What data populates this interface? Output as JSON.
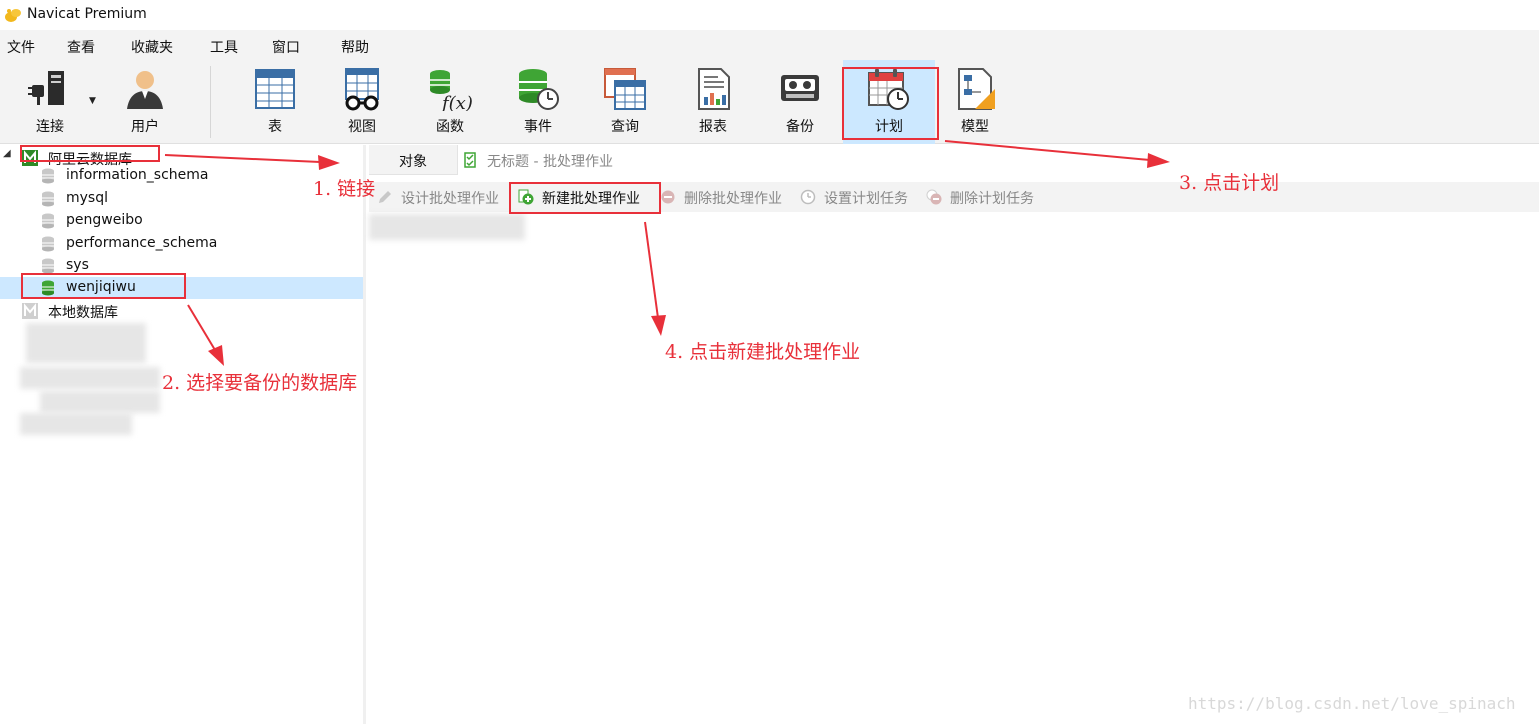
{
  "window": {
    "title": "Navicat Premium"
  },
  "menu": [
    "文件",
    "查看",
    "收藏夹",
    "工具",
    "窗口",
    "帮助"
  ],
  "toolbar": {
    "connect": "连接",
    "user": "用户",
    "table": "表",
    "view": "视图",
    "function": "函数",
    "event": "事件",
    "query": "查询",
    "report": "报表",
    "backup": "备份",
    "plan": "计划",
    "model": "模型",
    "active": "plan"
  },
  "sidebar": {
    "connection": "阿里云数据库",
    "databases": [
      "information_schema",
      "mysql",
      "pengweibo",
      "performance_schema",
      "sys",
      "wenjiqiwu"
    ],
    "selected": "wenjiqiwu",
    "local_connection": "本地数据库"
  },
  "tabs": {
    "objects": "对象",
    "batchjob_title": "无标题 - 批处理作业"
  },
  "actions": {
    "design": "设计批处理作业",
    "new": "新建批处理作业",
    "delete": "删除批处理作业",
    "set_schedule": "设置计划任务",
    "delete_schedule": "删除计划任务"
  },
  "annotations": {
    "step1": "1. 链接",
    "step2": "2. 选择要备份的数据库",
    "step3": "3. 点击计划",
    "step4": "4. 点击新建批处理作业"
  },
  "watermark": "https://blog.csdn.net/love_spinach",
  "colors": {
    "annotation": "#e8303a",
    "selection": "#cde8ff",
    "toolbar_active": "#cce8ff"
  }
}
